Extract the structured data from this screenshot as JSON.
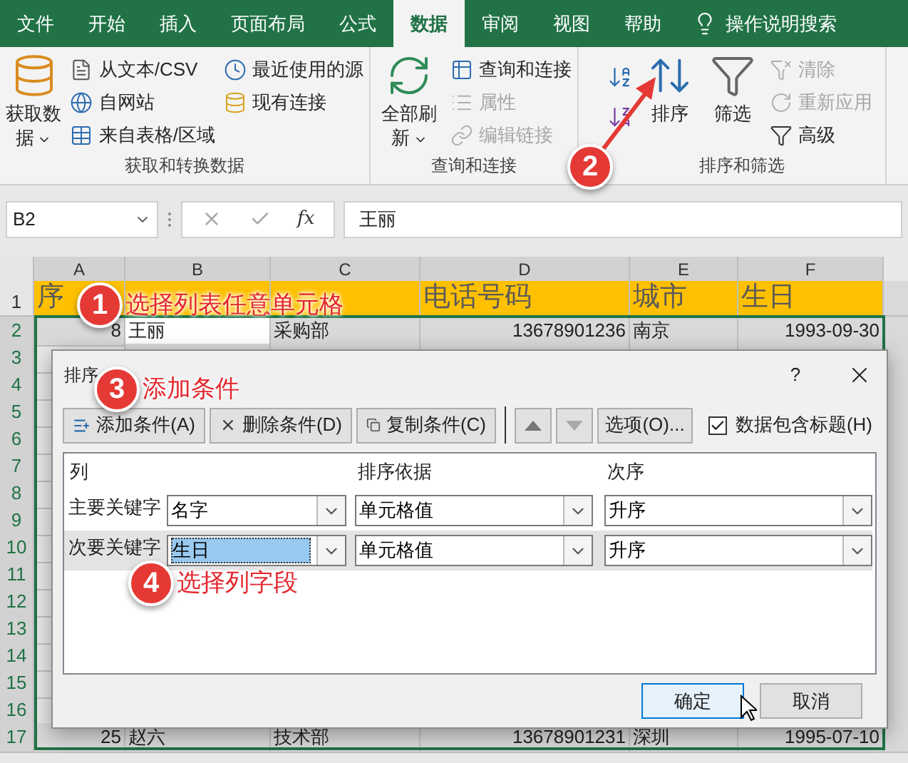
{
  "ribbon_tabs": [
    {
      "label": "文件",
      "selected": false
    },
    {
      "label": "开始",
      "selected": false
    },
    {
      "label": "插入",
      "selected": false
    },
    {
      "label": "页面布局",
      "selected": false
    },
    {
      "label": "公式",
      "selected": false
    },
    {
      "label": "数据",
      "selected": true
    },
    {
      "label": "审阅",
      "selected": false
    },
    {
      "label": "视图",
      "selected": false
    },
    {
      "label": "帮助",
      "selected": false
    }
  ],
  "tell_me": "操作说明搜索",
  "ribbon_groups": [
    {
      "label": "获取和转换数据",
      "items": [
        {
          "kind": "large",
          "label": "获取数据",
          "menu": true,
          "disabled": false
        },
        {
          "kind": "small",
          "label": "从文本/CSV",
          "disabled": false
        },
        {
          "kind": "small",
          "label": "自网站",
          "disabled": false
        },
        {
          "kind": "small",
          "label": "来自表格/区域",
          "disabled": false
        },
        {
          "kind": "small",
          "label": "最近使用的源",
          "disabled": false
        },
        {
          "kind": "small",
          "label": "现有连接",
          "disabled": false
        }
      ]
    },
    {
      "label": "查询和连接",
      "items": [
        {
          "kind": "large",
          "label": "全部刷新",
          "menu": true,
          "disabled": false
        },
        {
          "kind": "small",
          "label": "查询和连接",
          "disabled": false
        },
        {
          "kind": "small",
          "label": "属性",
          "disabled": true
        },
        {
          "kind": "small",
          "label": "编辑链接",
          "disabled": true
        }
      ]
    },
    {
      "label": "排序和筛选",
      "items": [
        {
          "kind": "icon",
          "disabled": false
        },
        {
          "kind": "icon",
          "disabled": false
        },
        {
          "kind": "large",
          "label": "排序",
          "menu": false,
          "disabled": false
        },
        {
          "kind": "large",
          "label": "筛选",
          "menu": false,
          "disabled": false
        },
        {
          "kind": "small",
          "label": "清除",
          "disabled": true
        },
        {
          "kind": "small",
          "label": "重新应用",
          "disabled": true
        },
        {
          "kind": "small",
          "label": "高级",
          "disabled": false
        }
      ]
    }
  ],
  "formula_bar": {
    "name_box": "B2",
    "insert_function": "fx",
    "formula": "王丽"
  },
  "sheet": {
    "columns": [
      "A",
      "B",
      "C",
      "D",
      "E",
      "F"
    ],
    "rows": [
      {
        "number": "1",
        "kind": "header",
        "in_selection": false,
        "cells": [
          {
            "text": "序"
          },
          {
            "text": "电话号码"
          },
          {
            "text": "城市"
          },
          {
            "text": "生日"
          }
        ]
      },
      {
        "number": "2",
        "kind": "data",
        "in_selection": true,
        "cells": [
          {
            "text": "8",
            "selected": false
          },
          {
            "text": "王丽",
            "selected": true
          },
          {
            "text": "采购部",
            "selected": false
          },
          {
            "text": "13678901236",
            "selected": false
          },
          {
            "text": "南京",
            "selected": false
          },
          {
            "text": "1993-09-30",
            "selected": false
          }
        ]
      },
      {
        "number": "3",
        "kind": "data",
        "in_selection": true
      },
      {
        "number": "4",
        "kind": "data",
        "in_selection": true
      },
      {
        "number": "5",
        "kind": "data",
        "in_selection": true
      },
      {
        "number": "6",
        "kind": "data",
        "in_selection": true
      },
      {
        "number": "7",
        "kind": "data",
        "in_selection": true
      },
      {
        "number": "8",
        "kind": "data",
        "in_selection": true
      },
      {
        "number": "9",
        "kind": "data",
        "in_selection": true
      },
      {
        "number": "10",
        "kind": "data",
        "in_selection": true
      },
      {
        "number": "11",
        "kind": "data",
        "in_selection": true
      },
      {
        "number": "12",
        "kind": "data",
        "in_selection": true
      },
      {
        "number": "13",
        "kind": "data",
        "in_selection": true
      },
      {
        "number": "14",
        "kind": "data",
        "in_selection": true
      },
      {
        "number": "15",
        "kind": "data",
        "in_selection": true
      },
      {
        "number": "16",
        "kind": "data",
        "in_selection": true
      },
      {
        "number": "17",
        "kind": "data",
        "in_selection": true,
        "cells": [
          {
            "text": "25",
            "selected": false
          },
          {
            "text": "赵六",
            "selected": false
          },
          {
            "text": "技术部",
            "selected": false
          },
          {
            "text": "13678901231",
            "selected": false
          },
          {
            "text": "深圳",
            "selected": false
          },
          {
            "text": "1995-07-10",
            "selected": false
          }
        ]
      }
    ]
  },
  "sort_dialog": {
    "title": "排序",
    "help": "?",
    "toolbar": [
      {
        "kind": "add",
        "label": "添加条件(A)",
        "disabled": false
      },
      {
        "kind": "delete",
        "label": "删除条件(D)",
        "disabled": false
      },
      {
        "kind": "copy",
        "label": "复制条件(C)",
        "disabled": false
      },
      {
        "kind": "up",
        "disabled": false
      },
      {
        "kind": "down",
        "disabled": true
      },
      {
        "kind": "options",
        "label": "选项(O)...",
        "disabled": false
      }
    ],
    "has_headers": {
      "label": "数据包含标题(H)",
      "checked": true
    },
    "columns": [
      "列",
      "排序依据",
      "次序"
    ],
    "levels": [
      {
        "label": "主要关键字",
        "column": "名字",
        "sort_on": "单元格值",
        "order": "升序",
        "selected": false
      },
      {
        "label": "次要关键字",
        "column": "生日",
        "sort_on": "单元格值",
        "order": "升序",
        "selected": true
      }
    ],
    "buttons": [
      {
        "label": "确定",
        "focused": true
      },
      {
        "label": "取消",
        "focused": false
      }
    ]
  },
  "annotations": [
    {
      "kind": "callout",
      "number": "1",
      "text": "选择列表任意单元格"
    },
    {
      "kind": "pointer",
      "number": "2"
    },
    {
      "kind": "callout",
      "number": "3",
      "text": "添加条件"
    },
    {
      "kind": "callout",
      "number": "4",
      "text": "选择列字段"
    }
  ]
}
